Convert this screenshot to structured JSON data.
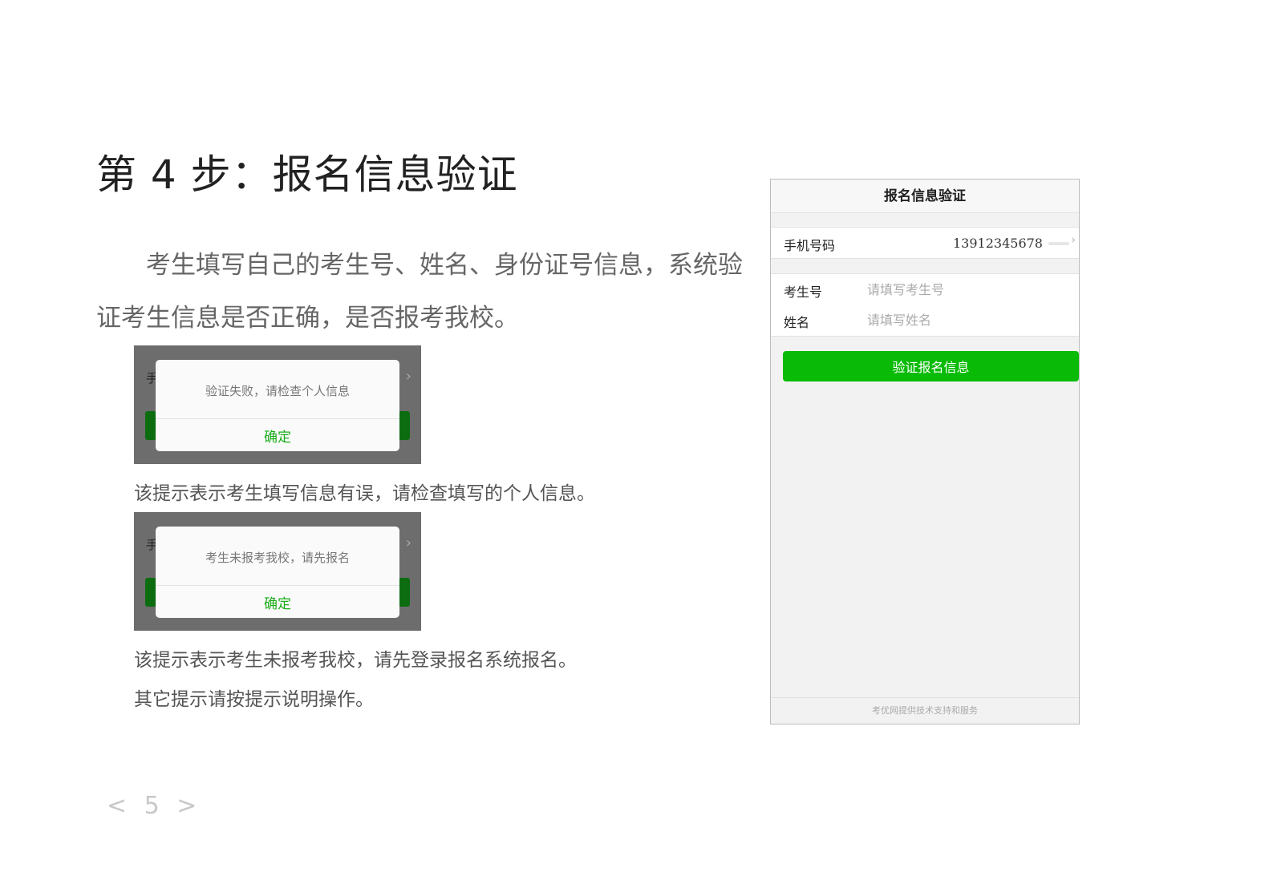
{
  "title": "第 4 步：报名信息验证",
  "intro": "考生填写自己的考生号、姓名、身份证号信息，系统验证考生信息是否正确，是否报考我校。",
  "dialogs": [
    {
      "bg_char": "手",
      "bg_chevron": "›",
      "message": "验证失败，请检查个人信息",
      "button": "确定",
      "caption": "该提示表示考生填写信息有误，请检查填写的个人信息。"
    },
    {
      "bg_char": "手",
      "bg_chevron": "›",
      "message": "考生未报考我校，请先报名",
      "button": "确定",
      "caption": "该提示表示考生未报考我校，请先登录报名系统报名。"
    }
  ],
  "note": "其它提示请按提示说明操作。",
  "page_number": "< 5 >",
  "phone": {
    "header": "报名信息验证",
    "phone_label": "手机号码",
    "phone_value": "13912345678",
    "chevron": "›",
    "exam_label": "考生号",
    "exam_placeholder": "请填写考生号",
    "name_label": "姓名",
    "name_placeholder": "请填写姓名",
    "verify_button": "验证报名信息",
    "footer": "考优网提供技术支持和服务"
  },
  "colors": {
    "accent_green": "#09bb07",
    "dialog_ok_green": "#1aad19"
  }
}
